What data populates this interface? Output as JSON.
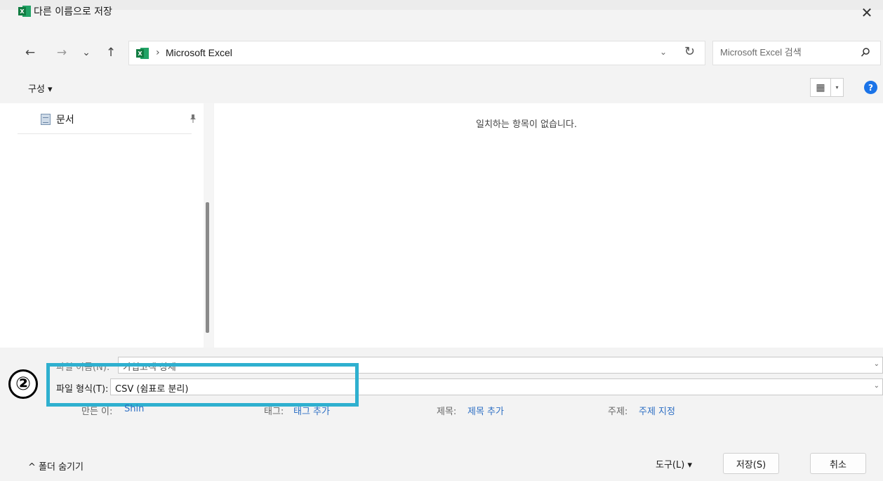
{
  "window": {
    "title": "다른 이름으로 저장",
    "close_glyph": "✕"
  },
  "nav": {
    "back_glyph": "←",
    "forward_glyph": "→",
    "recent_glyph": "⌄",
    "up_glyph": "↑"
  },
  "address": {
    "separator": "›",
    "path": "Microsoft Excel",
    "dropdown_glyph": "⌄",
    "refresh_glyph": "↻"
  },
  "search": {
    "placeholder": "Microsoft Excel 검색"
  },
  "toolbar": {
    "organize_label": "구성 ▾",
    "view_glyph": "▦",
    "view_dropdown_glyph": "▾",
    "help_glyph": "?"
  },
  "nav_pane": {
    "items": [
      {
        "label": "문서",
        "icon": "document-icon",
        "pinned": true
      }
    ],
    "pin_glyph": "📌"
  },
  "file_list": {
    "empty_message": "일치하는 항목이 없습니다."
  },
  "details": {
    "filename_label": "파일 이름(N):",
    "filename_value": "가입고객 상세",
    "filetype_label": "파일 형식(T):",
    "filetype_value": "CSV (쉼표로 분리)",
    "author_label": "만든 이:",
    "author_value": "Shin",
    "tags_label": "태그:",
    "tags_value": "태그 추가",
    "title_label": "제목:",
    "title_value": "제목 추가",
    "subject_label": "주제:",
    "subject_value": "주제 지정",
    "caret_glyph": "⌄"
  },
  "annotation": {
    "step_marker": "②",
    "highlight_color": "#2fb0cf"
  },
  "footer": {
    "hide_folders_label": "^ 폴더 숨기기",
    "tools_label": "도구(L)  ▾",
    "save_label": "저장(S)",
    "cancel_label": "취소"
  },
  "colors": {
    "excel_green": "#1d6f42",
    "link_blue": "#2d6fc4",
    "help_blue": "#1a73e8"
  }
}
